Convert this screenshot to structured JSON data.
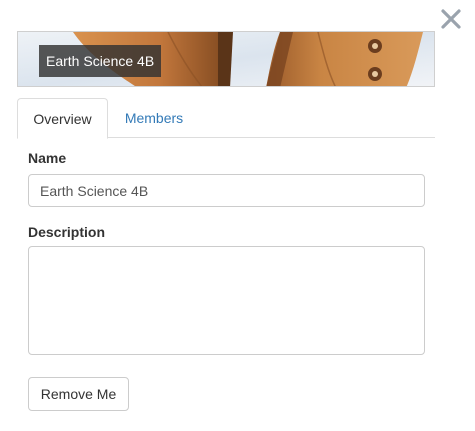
{
  "dialog": {
    "close_icon": "close-x-icon"
  },
  "banner": {
    "title": "Earth Science 4B",
    "image": "butterfly-wings-image"
  },
  "tabs": [
    {
      "label": "Overview",
      "active": true
    },
    {
      "label": "Members",
      "active": false
    }
  ],
  "form": {
    "name": {
      "label": "Name",
      "value": "Earth Science 4B"
    },
    "description": {
      "label": "Description",
      "value": ""
    },
    "remove_button": "Remove Me"
  },
  "colors": {
    "link": "#337ab7",
    "close_icon": "#9aa3ad",
    "banner_label_bg": "#323232",
    "wing_orange": "#c97a3a",
    "wing_dark": "#6b3d1e"
  }
}
